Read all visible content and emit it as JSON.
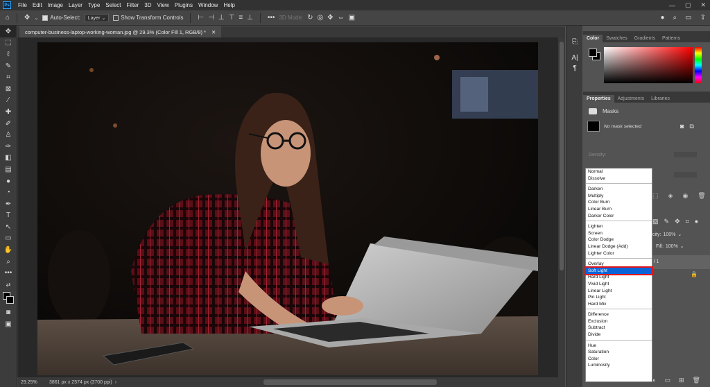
{
  "menu": [
    "File",
    "Edit",
    "Image",
    "Layer",
    "Type",
    "Select",
    "Filter",
    "3D",
    "View",
    "Plugins",
    "Window",
    "Help"
  ],
  "options": {
    "auto_select_label": "Auto-Select:",
    "layer_value": "Layer",
    "transform_label": "Show Transform Controls",
    "mode_3d": "3D Mode:"
  },
  "document": {
    "tab_title": "computer-business-laptop-working-woman.jpg @ 29.3% (Color Fill 1, RGB/8) *",
    "zoom": "29.25%",
    "dimensions": "3861 px x 2574 px (3700 ppi)"
  },
  "color_panel": {
    "tabs": [
      "Color",
      "Swatches",
      "Gradients",
      "Patterns"
    ]
  },
  "properties_panel": {
    "tabs": [
      "Properties",
      "Adjustments",
      "Libraries"
    ],
    "masks_label": "Masks",
    "no_mask": "No mask selected",
    "density_label": "Density:"
  },
  "layers_partial": {
    "opacity_label": "city:",
    "opacity_value": "100%",
    "fill_label": "Fill:",
    "fill_value": "100%",
    "layer_name_fragment": "l 1"
  },
  "blend_modes": {
    "groups": [
      [
        "Normal",
        "Dissolve"
      ],
      [
        "Darken",
        "Multiply",
        "Color Burn",
        "Linear Burn",
        "Darker Color"
      ],
      [
        "Lighten",
        "Screen",
        "Color Dodge",
        "Linear Dodge (Add)",
        "Lighter Color"
      ],
      [
        "Overlay",
        "Soft Light",
        "Hard Light",
        "Vivid Light",
        "Linear Light",
        "Pin Light",
        "Hard Mix"
      ],
      [
        "Difference",
        "Exclusion",
        "Subtract",
        "Divide"
      ],
      [
        "Hue",
        "Saturation",
        "Color",
        "Luminosity"
      ]
    ],
    "selected": "Soft Light"
  }
}
